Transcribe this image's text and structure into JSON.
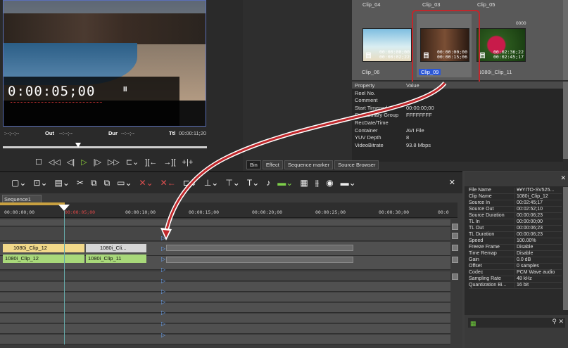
{
  "player": {
    "timecode": "0:00:05;00",
    "pause_glyph": "II",
    "tc_in": ":--;--;--",
    "out_label": "Out",
    "out_value": "--:--;--",
    "dur_label": "Dur",
    "dur_value": "--:--;--",
    "ttl_label": "Ttl",
    "ttl_value": "00:00:11;20",
    "controls": [
      "stop-icon",
      "rewind-icon",
      "step-back-icon",
      "play-icon",
      "step-forward-icon",
      "fast-forward-icon",
      "loop-icon",
      "mark-in-icon",
      "mark-out-icon",
      "split-icon"
    ]
  },
  "bin": {
    "clips_top": [
      "Clip_04",
      "Clip_03",
      "Clip_05"
    ],
    "clip06": {
      "name": "Clip_06",
      "tc1": "00:00:00;00",
      "tc2": "00:00:02;22"
    },
    "clip09": {
      "name": "Clip_09",
      "tc1": "00:00:00;00",
      "tc2": "00:00:15;06"
    },
    "clip11": {
      "name": "1080i_Clip_11",
      "tc1": "00:02:36;22",
      "tc2": "00:02:45;17",
      "top": "0000"
    },
    "property_header": "Property",
    "value_header": "Value",
    "properties": [
      {
        "k": "Reel No.",
        "v": ""
      },
      {
        "k": "Comment",
        "v": ""
      },
      {
        "k": "Start Timecode",
        "v": "00:00:00;00"
      },
      {
        "k": "Start Binary Group",
        "v": "FFFFFFFF"
      },
      {
        "k": "RecDate/Time",
        "v": ""
      },
      {
        "k": "Container",
        "v": "AVI File"
      },
      {
        "k": "YUV Depth",
        "v": "8"
      },
      {
        "k": "VideoBitrate",
        "v": "93.8 Mbps"
      }
    ],
    "tabs": [
      "Bin",
      "Effect",
      "Sequence marker",
      "Source Browser"
    ]
  },
  "timeline": {
    "sequence_tab": "Sequence1",
    "ruler": [
      "00:00:00;00",
      "00:00:05;00",
      "00:00:10;00",
      "00:00:15;00",
      "00:00:20;00",
      "00:00:25;00",
      "00:00:30;00",
      "00:0"
    ],
    "clip_v1": "1080i_Clip_12",
    "clip_v2": "1080i_Cli...",
    "clip_a1": "1080i_Clip_12",
    "clip_a2": "1080i_Clip_11"
  },
  "info": {
    "rows": [
      {
        "k": "File Name",
        "v": "¥¥YITO-SV525..."
      },
      {
        "k": "Clip Name",
        "v": "1080i_Clip_12"
      },
      {
        "k": "Source In",
        "v": "00:02:45;17"
      },
      {
        "k": "Source Out",
        "v": "00:02:52;10"
      },
      {
        "k": "Source Duration",
        "v": "00:00:06;23"
      },
      {
        "k": "TL In",
        "v": "00:00:00;00"
      },
      {
        "k": "TL Out",
        "v": "00:00:06;23"
      },
      {
        "k": "TL Duration",
        "v": "00:00:06;23"
      },
      {
        "k": "Speed",
        "v": "100.00%"
      },
      {
        "k": "Freeze Frame",
        "v": "Disable"
      },
      {
        "k": "Time Remap",
        "v": "Disable"
      },
      {
        "k": "Gain",
        "v": "0.0 dB"
      },
      {
        "k": "Offset",
        "v": "0 samples"
      },
      {
        "k": "Codec",
        "v": "PCM Wave audio"
      },
      {
        "k": "Sampling Rate",
        "v": "48 kHz"
      },
      {
        "k": "Quantization Bi...",
        "v": "16 bit"
      }
    ]
  },
  "colors": {
    "accent": "#c0282c",
    "selection": "#2b57d6",
    "play": "#8fd13a"
  }
}
